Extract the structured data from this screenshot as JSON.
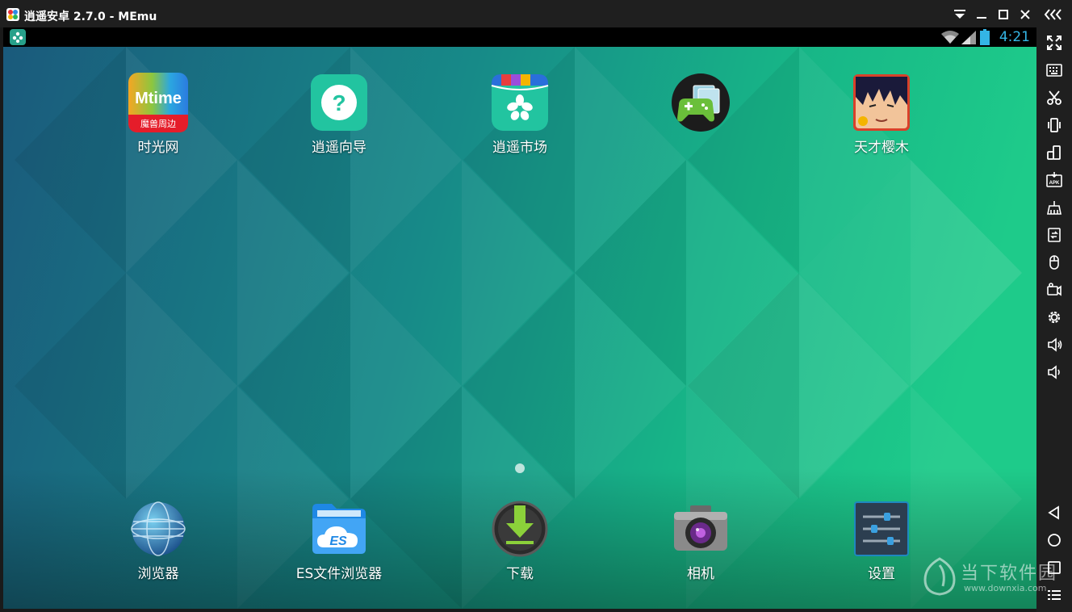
{
  "window": {
    "title": "逍遥安卓 2.7.0 - MEmu"
  },
  "status_bar": {
    "time": "4:21"
  },
  "home": {
    "top_row": [
      {
        "label": "时光网",
        "icon": "mtime-icon",
        "icon_text": "Mtime",
        "icon_sub": "魔兽周边"
      },
      {
        "label": "逍遥向导",
        "icon": "help-guide-icon"
      },
      {
        "label": "逍遥市场",
        "icon": "market-icon"
      },
      {
        "label": "",
        "icon": "game-center-icon"
      },
      {
        "label": "天才樱木",
        "icon": "anime-game-icon"
      }
    ],
    "dock": [
      {
        "label": "浏览器",
        "icon": "globe-icon"
      },
      {
        "label": "ES文件浏览器",
        "icon": "es-folder-icon",
        "icon_text": "ES"
      },
      {
        "label": "下载",
        "icon": "download-icon"
      },
      {
        "label": "相机",
        "icon": "camera-icon"
      },
      {
        "label": "设置",
        "icon": "settings-sliders-icon"
      }
    ]
  },
  "watermark": {
    "name": "当下软件园",
    "url": "www.downxia.com"
  },
  "colors": {
    "wallpaper_left": "#1a5f80",
    "wallpaper_right": "#1ec98a",
    "status_time": "#34b5e5",
    "chrome": "#1f1f1f"
  }
}
